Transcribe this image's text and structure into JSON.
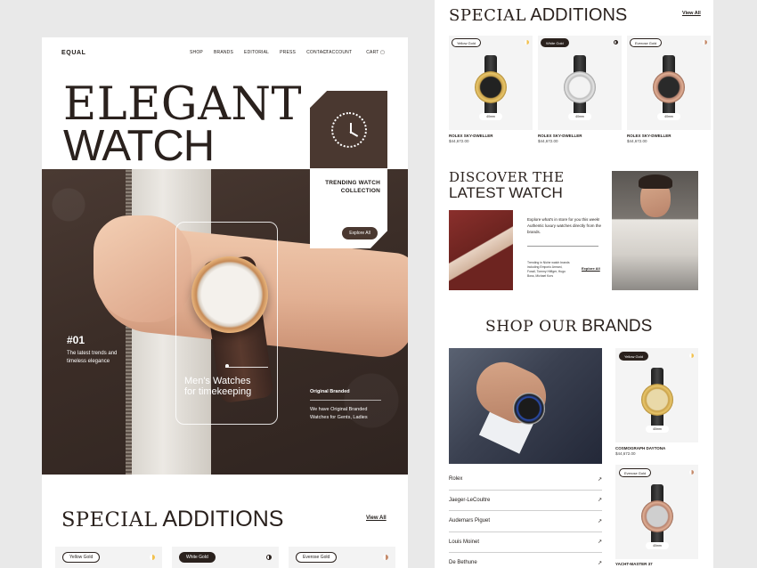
{
  "nav": {
    "logo": "EQUAL",
    "links": [
      "SHOP",
      "BRANDS",
      "EDITORIAL",
      "PRESS",
      "CONTACT"
    ],
    "account": "ACCOUNT",
    "cart": "CART"
  },
  "hero": {
    "title_line1": "ELEGANT",
    "title_line2": "WATCH",
    "trending": "TRENDING WATCH COLLECTION",
    "explore_label": "Explore All",
    "number": "#01",
    "number_desc": "The latest trends and timeless elegance",
    "mens": "Men's Watches for timekeeping",
    "original_title": "Original Branded",
    "original_desc": "We have Original Branded Watches for Gents, Ladies"
  },
  "special": {
    "title_thin": "SPECIAL",
    "title_bold": "ADDITIONS",
    "view_all": "View All",
    "tags": [
      "Yellow Gold",
      "White Gold",
      "Everose Gold"
    ],
    "size": "40mm",
    "products": [
      {
        "name": "ROLEX SKY-DWELLER",
        "price": "$44,672.00"
      },
      {
        "name": "ROLEX SKY-DWELLER",
        "price": "$44,672.00"
      },
      {
        "name": "ROLEX SKY-DWELLER",
        "price": "$44,672.00"
      }
    ]
  },
  "discover": {
    "title_line1": "DISCOVER THE",
    "title_line2": "LATEST WATCH",
    "text": "Explore what's in store for you this week! Authentic luxury watches directly from the brands.",
    "small": "Trending in Niche watch brands including Emporio Armani, Fossil, Tommy Hilfiger, Hugo Boss, Michael Kors",
    "explore_label": "Explore All"
  },
  "brands": {
    "title_thin": "SHOP OUR",
    "title_bold": "BRANDS",
    "list": [
      "Rolex",
      "Jaeger-LeCoultre",
      "Audemars Piguet",
      "Louis Moinet",
      "De Bethune"
    ],
    "arrow": "↗",
    "card1": {
      "tag": "Yellow Gold",
      "size": "40mm",
      "name": "COSMOGRAPH DAYTONA",
      "price": "$44,672.00"
    },
    "card2": {
      "tag": "Everose Gold",
      "size": "40mm",
      "name": "YACHT-MASTER 37"
    }
  },
  "colors": {
    "brown": "#4a3830",
    "gold": "#f2c14e",
    "black": "#2a211d"
  }
}
